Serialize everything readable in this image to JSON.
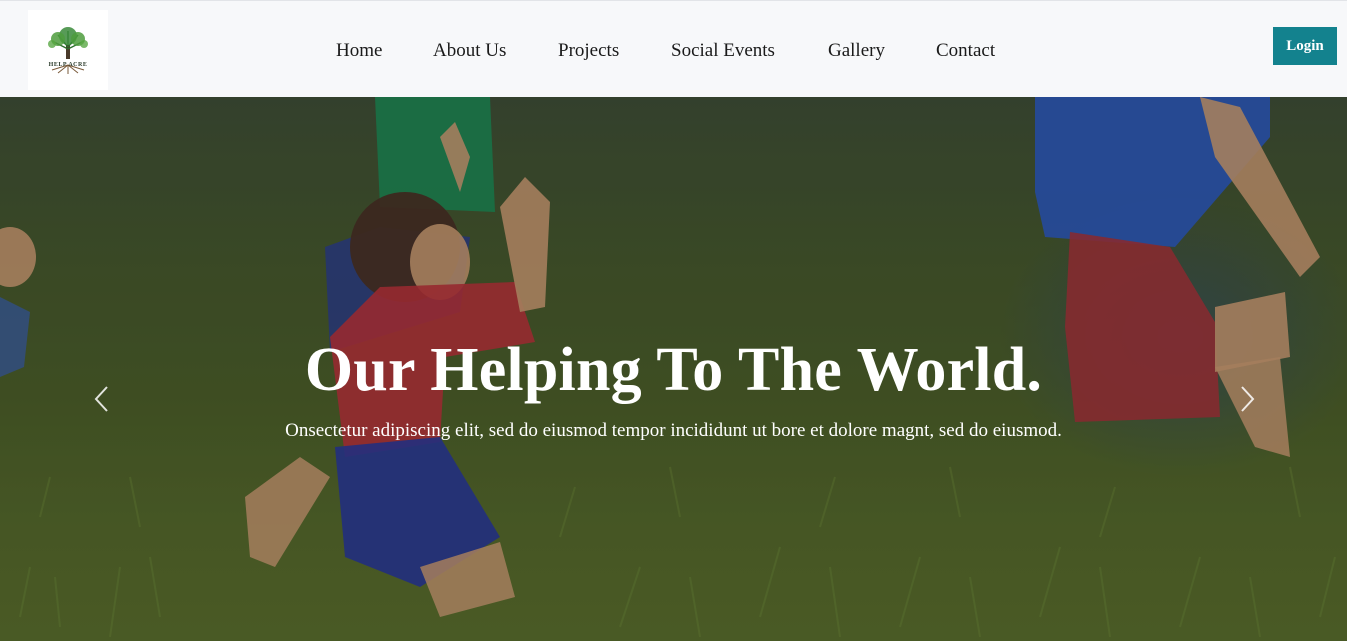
{
  "brand": {
    "logo_text": "HELP ACRE",
    "logo_icon": "tree-icon"
  },
  "nav": {
    "items": [
      {
        "label": "Home"
      },
      {
        "label": "About Us"
      },
      {
        "label": "Projects"
      },
      {
        "label": "Social Events"
      },
      {
        "label": "Gallery"
      },
      {
        "label": "Contact"
      }
    ],
    "login_label": "Login"
  },
  "hero": {
    "title": "Our Helping To The World.",
    "subtitle": "Onsectetur adipiscing elit, sed do eiusmod tempor incididunt ut bore et dolore magnt, sed do eiusmod.",
    "prev_icon": "chevron-left-icon",
    "next_icon": "chevron-right-icon"
  },
  "colors": {
    "login_bg": "#13828e",
    "nav_bg": "#f7f8fa",
    "hero_text": "#ffffff"
  }
}
